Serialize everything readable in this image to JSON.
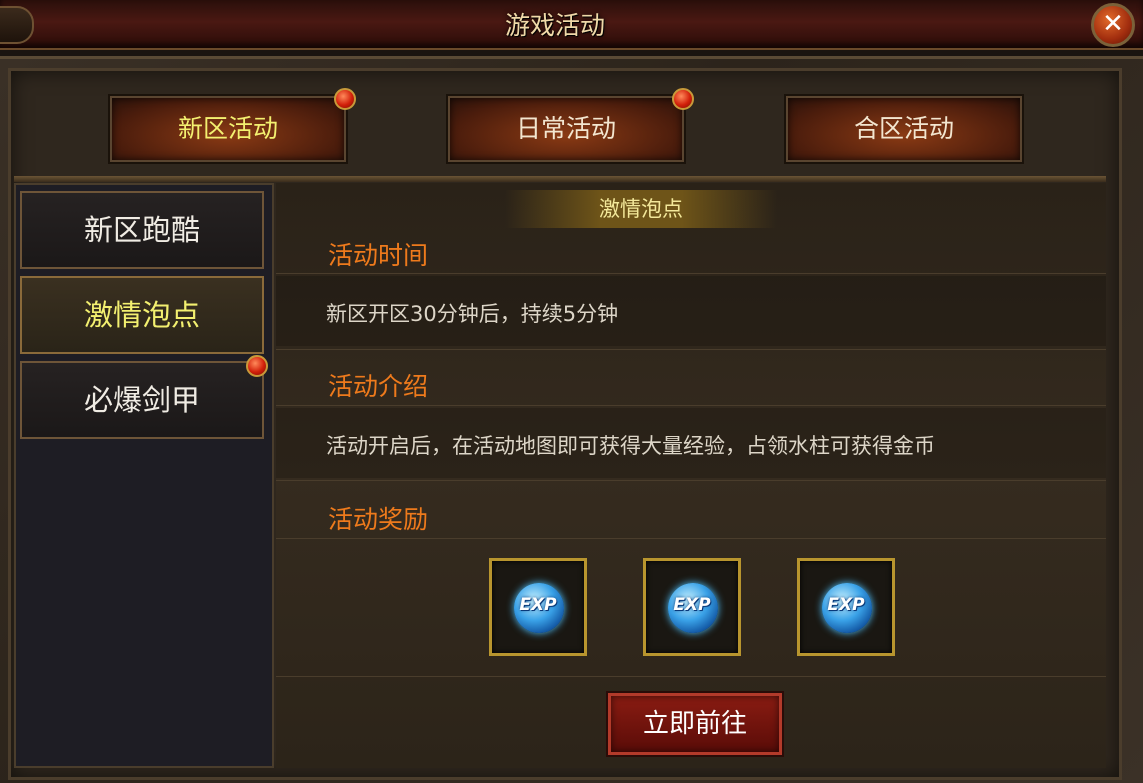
{
  "window": {
    "title": "游戏活动",
    "close_icon": "close-icon"
  },
  "tabs": [
    {
      "label": "新区活动",
      "active": true,
      "has_dot": true
    },
    {
      "label": "日常活动",
      "active": false,
      "has_dot": true
    },
    {
      "label": "合区活动",
      "active": false,
      "has_dot": false
    }
  ],
  "sidebar": {
    "items": [
      {
        "label": "新区跑酷",
        "active": false,
        "has_dot": false
      },
      {
        "label": "激情泡点",
        "active": true,
        "has_dot": false
      },
      {
        "label": "必爆剑甲",
        "active": false,
        "has_dot": true
      }
    ]
  },
  "detail": {
    "header": "激情泡点",
    "time_title": "活动时间",
    "time_text": "新区开区30分钟后，持续5分钟",
    "intro_title": "活动介绍",
    "intro_text": "活动开启后，在活动地图即可获得大量经验，占领水柱可获得金币",
    "reward_title": "活动奖励",
    "rewards": [
      {
        "label": "EXP",
        "icon": "exp-orb-icon"
      },
      {
        "label": "EXP",
        "icon": "exp-orb-icon"
      },
      {
        "label": "EXP",
        "icon": "exp-orb-icon"
      }
    ],
    "go_button": "立即前往"
  }
}
